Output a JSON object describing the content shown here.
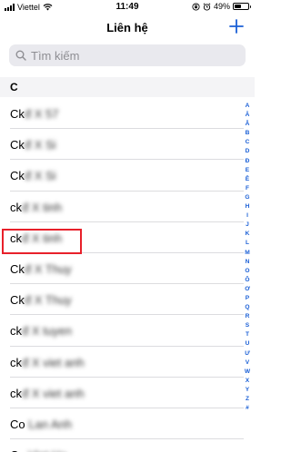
{
  "status_bar": {
    "carrier": "Viettel",
    "time": "11:49",
    "battery": "49%",
    "battery_level": 0.49
  },
  "nav": {
    "title": "Liên hệ",
    "add_icon": "plus-icon"
  },
  "search": {
    "placeholder": "Tìm kiếm"
  },
  "section": {
    "header": "C"
  },
  "contacts": [
    {
      "prefix": "Ck",
      "rest": "đ X 57"
    },
    {
      "prefix": "Ck",
      "rest": "đ X Si"
    },
    {
      "prefix": "Ck",
      "rest": "đ X Si"
    },
    {
      "prefix": "ck",
      "rest": "đ X tinh"
    },
    {
      "prefix": "ck",
      "rest": "đ X tinh"
    },
    {
      "prefix": "Ck",
      "rest": "đ X Thuy"
    },
    {
      "prefix": "Ck",
      "rest": "đ X Thuy"
    },
    {
      "prefix": "ck",
      "rest": "đ X tuyen"
    },
    {
      "prefix": "ck",
      "rest": "đ X viet anh"
    },
    {
      "prefix": "ck",
      "rest": "đ X viet anh"
    },
    {
      "prefix": "Co",
      "rest": " Lan Anh"
    },
    {
      "prefix": "Co",
      "rest": " Viet Ha"
    }
  ],
  "highlighted_index": 5,
  "index_letters": [
    "A",
    "Ă",
    "Â",
    "B",
    "C",
    "D",
    "Đ",
    "E",
    "Ê",
    "F",
    "G",
    "H",
    "I",
    "J",
    "K",
    "L",
    "M",
    "N",
    "O",
    "Ô",
    "Ơ",
    "P",
    "Q",
    "R",
    "S",
    "T",
    "U",
    "Ư",
    "V",
    "W",
    "X",
    "Y",
    "Z",
    "#"
  ],
  "colors": {
    "accent": "#1a5fd6",
    "highlight": "#e8202a",
    "search_bg": "#e9e9ee"
  }
}
